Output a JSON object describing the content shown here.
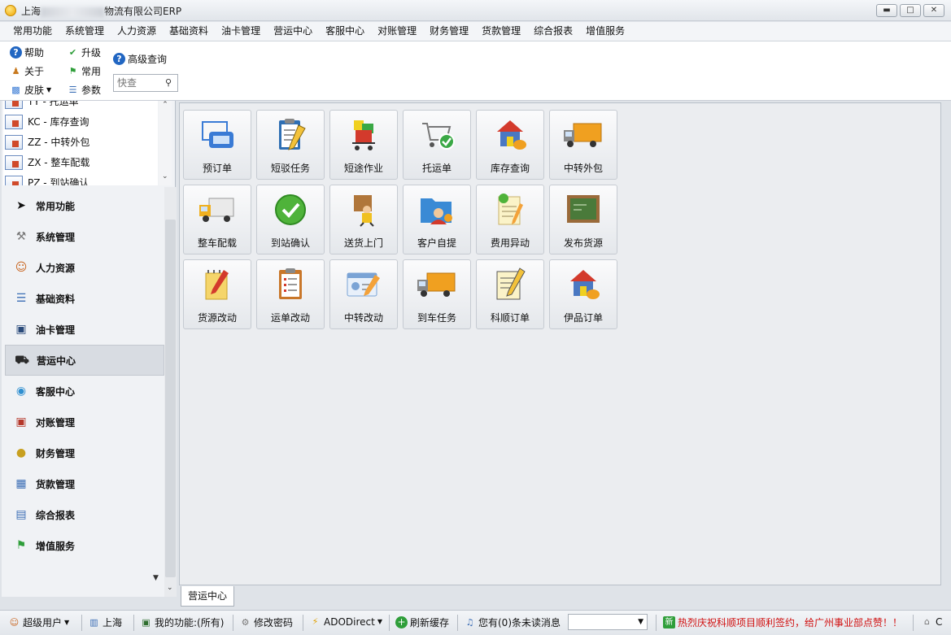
{
  "window": {
    "title_prefix": "上海",
    "title_suffix": "物流有限公司ERP",
    "btn_min": "▬",
    "btn_max": "□",
    "btn_close": "✕"
  },
  "menubar": [
    "常用功能",
    "系统管理",
    "人力资源",
    "基础资料",
    "油卡管理",
    "营运中心",
    "客服中心",
    "对账管理",
    "财务管理",
    "货款管理",
    "综合报表",
    "增值服务"
  ],
  "toolbar": {
    "help": "帮助",
    "about": "关于",
    "skin": "皮肤",
    "upgrade": "升级",
    "common": "常用",
    "params": "参数",
    "advanced_query": "高级查询",
    "quick_search_placeholder": "快查"
  },
  "tree": [
    {
      "label": "TY - 托运单"
    },
    {
      "label": "KC - 库存查询"
    },
    {
      "label": "ZZ - 中转外包"
    },
    {
      "label": "ZX - 整车配载"
    },
    {
      "label": "PZ - 到站确认"
    }
  ],
  "nav": [
    {
      "label": "常用功能",
      "icon": "cursor-icon"
    },
    {
      "label": "系统管理",
      "icon": "tools-icon"
    },
    {
      "label": "人力资源",
      "icon": "people-icon"
    },
    {
      "label": "基础资料",
      "icon": "list-icon"
    },
    {
      "label": "油卡管理",
      "icon": "card-icon"
    },
    {
      "label": "营运中心",
      "icon": "truck-icon"
    },
    {
      "label": "客服中心",
      "icon": "globe-icon"
    },
    {
      "label": "对账管理",
      "icon": "document-icon"
    },
    {
      "label": "财务管理",
      "icon": "coin-icon"
    },
    {
      "label": "货款管理",
      "icon": "ledger-icon"
    },
    {
      "label": "综合报表",
      "icon": "report-icon"
    },
    {
      "label": "增值服务",
      "icon": "flag-icon"
    }
  ],
  "tiles": [
    {
      "label": "预订单",
      "icon": "order-icon",
      "color": "#3a7bd5"
    },
    {
      "label": "短驳任务",
      "icon": "clipboard-icon",
      "color": "#2f6fb3"
    },
    {
      "label": "短途作业",
      "icon": "cart-boxes-icon",
      "color": "#d33a2c"
    },
    {
      "label": "托运单",
      "icon": "cart-check-icon",
      "color": "#3aa845"
    },
    {
      "label": "库存查询",
      "icon": "house-chart-icon",
      "color": "#4a78c2"
    },
    {
      "label": "中转外包",
      "icon": "truck-icon",
      "color": "#f0a020"
    },
    {
      "label": "整车配载",
      "icon": "van-icon",
      "color": "#f0b020"
    },
    {
      "label": "到站确认",
      "icon": "check-circle-icon",
      "color": "#4fb33a"
    },
    {
      "label": "送货上门",
      "icon": "delivery-man-icon",
      "color": "#b0763a"
    },
    {
      "label": "客户自提",
      "icon": "folder-user-icon",
      "color": "#3a8ad5"
    },
    {
      "label": "费用异动",
      "icon": "note-check-icon",
      "color": "#f5e7a0"
    },
    {
      "label": "发布货源",
      "icon": "board-icon",
      "color": "#4a7a3a"
    },
    {
      "label": "货源改动",
      "icon": "notepad-pencil-icon",
      "color": "#f5d56a"
    },
    {
      "label": "运单改动",
      "icon": "clipboard-list-icon",
      "color": "#c9772a"
    },
    {
      "label": "中转改动",
      "icon": "id-card-icon",
      "color": "#7aa3d5"
    },
    {
      "label": "到车任务",
      "icon": "truck-icon",
      "color": "#f0a020"
    },
    {
      "label": "科顺订单",
      "icon": "doc-pencil-icon",
      "color": "#f5e7a0"
    },
    {
      "label": "伊品订单",
      "icon": "house-chart-icon",
      "color": "#4a78c2"
    }
  ],
  "active_tab": "营运中心",
  "status": {
    "user": "超级用户",
    "location": "上海",
    "my_functions": "我的功能:(所有)",
    "change_password": "修改密码",
    "ado": "ADODirect",
    "refresh_cache": "刷新缓存",
    "messages": "您有(0)条未读消息",
    "marquee": "热烈庆祝科顺项目顺利签约，给广州事业部点赞！！",
    "tail": "C"
  },
  "colors": {
    "accent": "#3a7bd5",
    "marquee": "#d01010",
    "tick_green": "#2f9e3a"
  }
}
